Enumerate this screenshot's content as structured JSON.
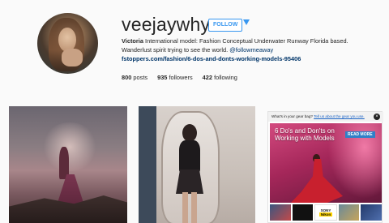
{
  "profile": {
    "username": "veejaywhy",
    "follow_label": "FOLLOW",
    "bio_name": "Victoria",
    "bio_text": " International model: Fashion Conceptual Underwater Runway Florida based. Wanderlust spirit trying to see the world. ",
    "bio_tag": "@followmeaway",
    "bio_link": "fstoppers.com/fashion/6-dos-and-donts-working-models-95406"
  },
  "stats": {
    "posts_count": "800",
    "posts_label": "posts",
    "followers_count": "935",
    "followers_label": "followers",
    "following_count": "422",
    "following_label": "following"
  },
  "ad": {
    "question": "What's in your gear bag?",
    "link_text": "Tell us about the gear you use.",
    "close_glyph": "×",
    "title": "6 Do's and Don'ts on Working with Models",
    "read_more": "READ MORE",
    "thumb_sony": "SONY",
    "thumb_nikon": "Nikon"
  },
  "colors": {
    "accent": "#3897f0",
    "link": "#003569",
    "ad_pink": "#a5275a"
  }
}
